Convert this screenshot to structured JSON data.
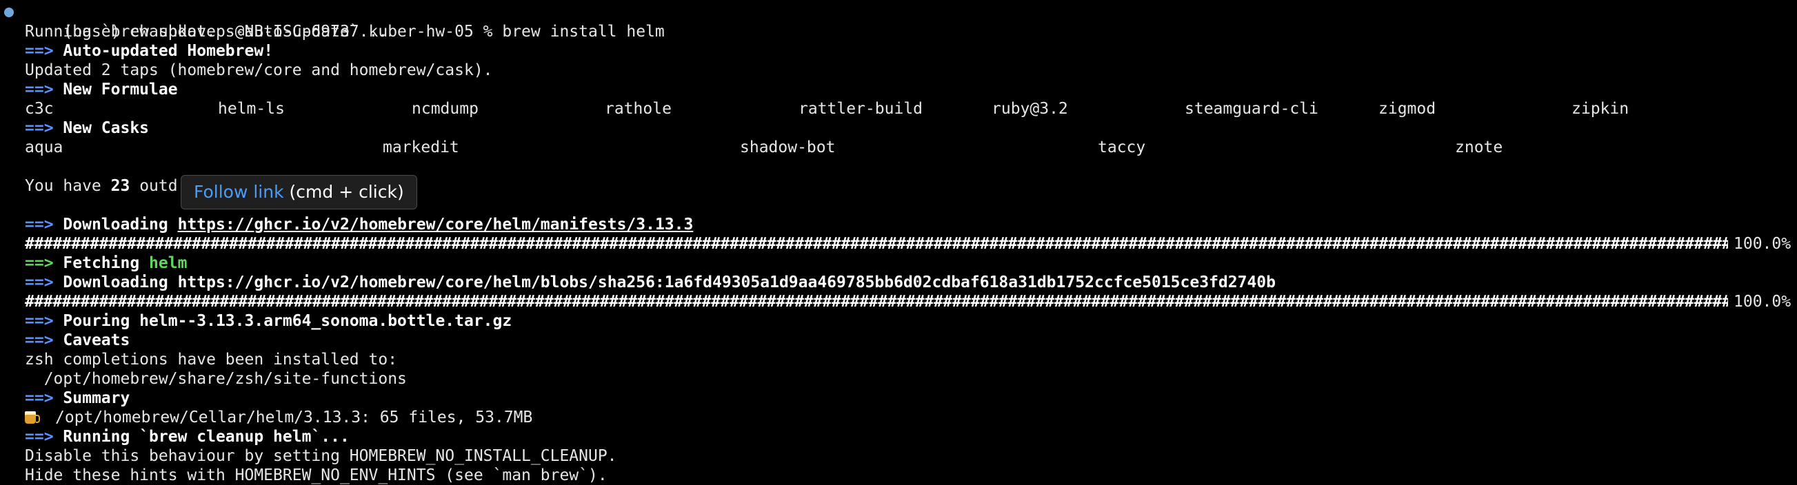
{
  "prompt": {
    "text": "(base) chashkov.ps@NB-ISC-69737 kuber-hw-05 % brew install helm"
  },
  "output": {
    "running_update": "Running `brew update --auto-update`...",
    "arrow": "==>",
    "auto_updated": "Auto-updated Homebrew!",
    "updated_taps": "Updated 2 taps (homebrew/core and homebrew/cask).",
    "new_formulae_header": "New Formulae",
    "formulae": [
      "c3c",
      "helm-ls",
      "ncmdump",
      "rathole",
      "rattler-build",
      "ruby@3.2",
      "steamguard-cli",
      "zigmod",
      "zipkin"
    ],
    "new_casks_header": "New Casks",
    "casks": [
      "aqua",
      "markedit",
      "shadow-bot",
      "taccy",
      "znote"
    ],
    "outdated_prefix": "You have ",
    "outdated_count": "23",
    "outdated_visible": "outd",
    "outdated_tail": ".",
    "downloading_label": "Downloading",
    "manifest_url": "https://ghcr.io/v2/homebrew/core/helm/manifests/3.13.3",
    "progress_1": "100.0%",
    "fetching_label": "Fetching",
    "fetching_pkg": "helm",
    "blob_download": "Downloading https://ghcr.io/v2/homebrew/core/helm/blobs/sha256:1a6fd49305a1d9aa469785bb6d02cdbaf618a31db1752ccfce5015ce3fd2740b",
    "progress_2": "100.0%",
    "pouring": "Pouring helm--3.13.3.arm64_sonoma.bottle.tar.gz",
    "caveats_header": "Caveats",
    "zsh_completions": "zsh completions have been installed to:",
    "zsh_path": "  /opt/homebrew/share/zsh/site-functions",
    "summary_header": "Summary",
    "summary_text": "/opt/homebrew/Cellar/helm/3.13.3: 65 files, 53.7MB",
    "cleanup": "Running `brew cleanup helm`...",
    "disable_hint": "Disable this behaviour by setting HOMEBREW_NO_INSTALL_CLEANUP.",
    "hide_hint": "Hide these hints with HOMEBREW_NO_ENV_HINTS (see `man brew`)."
  },
  "tooltip": {
    "link_text": "Follow link",
    "shortcut_text": " (cmd + click)"
  },
  "icons": {
    "prompt_marker": "prompt-marker-icon",
    "summary": "beer-mug-icon"
  },
  "colors": {
    "background": "#000000",
    "text": "#e6e6e6",
    "arrow_blue": "#5c8fff",
    "arrow_green": "#5fd75f",
    "tooltip_link": "#4d9cf5",
    "prompt_marker": "#6fa8dc"
  }
}
